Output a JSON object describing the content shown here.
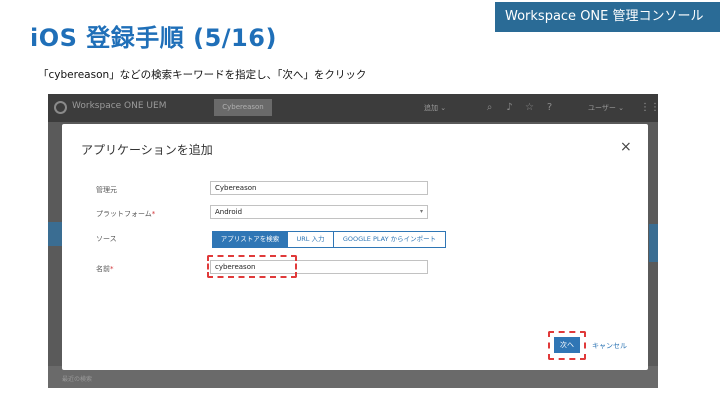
{
  "slide": {
    "title": "iOS 登録手順 (5/16)",
    "badge": "Workspace ONE 管理コンソール",
    "instruction": "「cybereason」などの検索キーワードを指定し、「次へ」をクリック"
  },
  "app": {
    "name": "Workspace ONE UEM",
    "org": "Cybereason",
    "add_menu": "追加 ⌄",
    "user_menu": "ユーザー ⌄",
    "bottom_text": "最近の検索"
  },
  "modal": {
    "title": "アプリケーションを追加",
    "close": "×",
    "fields": {
      "managed_by_label": "管理元",
      "managed_by_value": "Cybereason",
      "platform_label": "プラットフォーム",
      "platform_required": "*",
      "platform_value": "Android",
      "source_label": "ソース",
      "name_label": "名前",
      "name_required": "*",
      "name_value": "cybereason"
    },
    "source_options": [
      "アプリストアを検索",
      "URL 入力",
      "GOOGLE PLAY からインポート"
    ],
    "next_label": "次へ",
    "cancel_label": "キャンセル"
  },
  "colors": {
    "title_blue": "#1f6fb8",
    "badge_bg": "#2a6b96",
    "primary": "#2f76b5",
    "highlight": "#e03a3a"
  }
}
